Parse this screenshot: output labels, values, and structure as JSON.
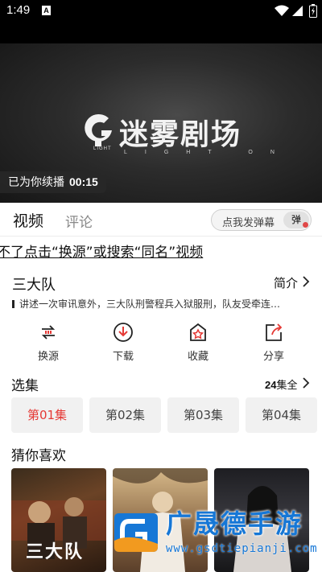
{
  "status_bar": {
    "time": "1:49",
    "notification_icon": "A",
    "icons": [
      "wifi-icon",
      "signal-icon",
      "battery-icon"
    ]
  },
  "player": {
    "logo_title": "迷雾剧场",
    "logo_mark_text": "LIGHT",
    "logo_sub": "LIGHT ON",
    "resume_label": "已为你续播",
    "resume_time": "00:15"
  },
  "tabs": {
    "video": "视频",
    "comment": "评论",
    "danmu_placeholder": "点我发弹幕",
    "danmu_toggle": "弹"
  },
  "notice": "不了点击“换源”或搜索“同名”视频",
  "show": {
    "title": "三大队",
    "intro_label": "简介",
    "description": "讲述一次审讯意外，三大队刑警程兵入狱服刑，队友受牵连…"
  },
  "actions": [
    {
      "label": "换源",
      "icon": "switch-source-icon"
    },
    {
      "label": "下载",
      "icon": "download-icon"
    },
    {
      "label": "收藏",
      "icon": "favorite-icon"
    },
    {
      "label": "分享",
      "icon": "share-icon"
    }
  ],
  "episodes": {
    "title": "选集",
    "count": "24",
    "count_suffix": "集全",
    "items": [
      "第01集",
      "第02集",
      "第03集",
      "第04集"
    ],
    "active_index": 0
  },
  "recommend": {
    "title": "猜你喜欢",
    "poster1_caption": "三大队"
  },
  "watermark": {
    "brand": "广晟德手游",
    "url": "www.gsdtiepianji.com"
  },
  "colors": {
    "accent_red": "#e53935",
    "watermark_blue": "#1677d6"
  }
}
